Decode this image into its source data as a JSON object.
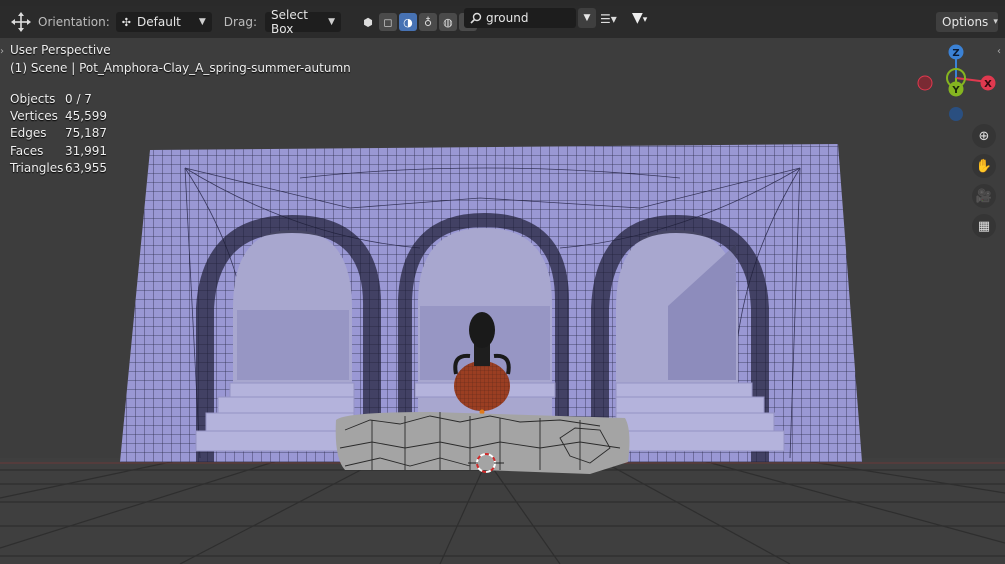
{
  "header": {
    "orientation_label": "Orientation:",
    "orientation_value": "Default",
    "drag_label": "Drag:",
    "drag_value": "Select Box",
    "search_value": "ground",
    "options_label": "Options"
  },
  "overlay": {
    "view_name": "User Perspective",
    "scene_info": "(1) Scene | Pot_Amphora-Clay_A_spring-summer-autumn"
  },
  "stats": [
    {
      "label": "Objects",
      "value": "0 / 7"
    },
    {
      "label": "Vertices",
      "value": "45,599"
    },
    {
      "label": "Edges",
      "value": "75,187"
    },
    {
      "label": "Faces",
      "value": "31,991"
    },
    {
      "label": "Triangles",
      "value": "63,955"
    }
  ],
  "gizmo": {
    "z": "Z",
    "y": "Y",
    "x": "X"
  },
  "colors": {
    "mesh": "#9a98d4",
    "wire": "#1e1e38",
    "accent": "#4772b3",
    "axis_x": "#e0394f",
    "axis_y": "#85b520",
    "axis_z": "#3b82d6"
  }
}
